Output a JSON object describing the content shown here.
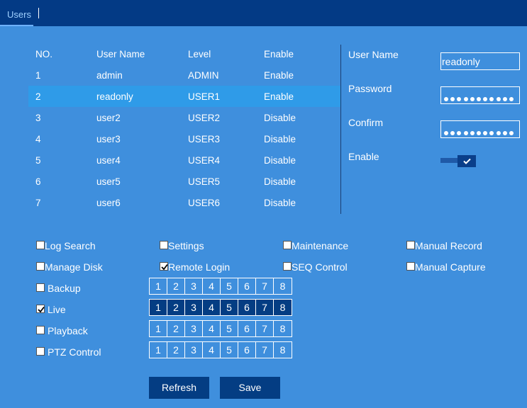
{
  "tabs": {
    "users_label": "Users"
  },
  "table": {
    "headers": {
      "no": "NO.",
      "name": "User Name",
      "level": "Level",
      "enable": "Enable"
    },
    "rows": [
      {
        "no": "1",
        "name": "admin",
        "level": "ADMIN",
        "enable": "Enable"
      },
      {
        "no": "2",
        "name": "readonly",
        "level": "USER1",
        "enable": "Enable"
      },
      {
        "no": "3",
        "name": "user2",
        "level": "USER2",
        "enable": "Disable"
      },
      {
        "no": "4",
        "name": "user3",
        "level": "USER3",
        "enable": "Disable"
      },
      {
        "no": "5",
        "name": "user4",
        "level": "USER4",
        "enable": "Disable"
      },
      {
        "no": "6",
        "name": "user5",
        "level": "USER5",
        "enable": "Disable"
      },
      {
        "no": "7",
        "name": "user6",
        "level": "USER6",
        "enable": "Disable"
      }
    ],
    "selected_row": "2"
  },
  "form": {
    "username_label": "User Name",
    "username_value": "readonly",
    "password_label": "Password",
    "confirm_label": "Confirm",
    "enable_label": "Enable",
    "enable_on": true
  },
  "permissions": {
    "log_search": {
      "label": "Log Search",
      "checked": false
    },
    "settings": {
      "label": "Settings",
      "checked": false
    },
    "maintenance": {
      "label": "Maintenance",
      "checked": false
    },
    "manual_record": {
      "label": "Manual Record",
      "checked": false
    },
    "manage_disk": {
      "label": "Manage Disk",
      "checked": false
    },
    "remote_login": {
      "label": "Remote Login",
      "checked": true
    },
    "seq_control": {
      "label": "SEQ Control",
      "checked": false
    },
    "manual_capture": {
      "label": "Manual Capture",
      "checked": false
    },
    "backup": {
      "label": "Backup",
      "checked": false
    },
    "live": {
      "label": "Live",
      "checked": true
    },
    "playback": {
      "label": "Playback",
      "checked": false
    },
    "ptz_control": {
      "label": "PTZ Control",
      "checked": false
    }
  },
  "channels": [
    "1",
    "2",
    "3",
    "4",
    "5",
    "6",
    "7",
    "8"
  ],
  "buttons": {
    "refresh": "Refresh",
    "save": "Save"
  },
  "colors": {
    "background": "#3f8fdd",
    "header": "#033a85",
    "selected_row": "#2f9be8",
    "active_dark": "#043d83"
  }
}
